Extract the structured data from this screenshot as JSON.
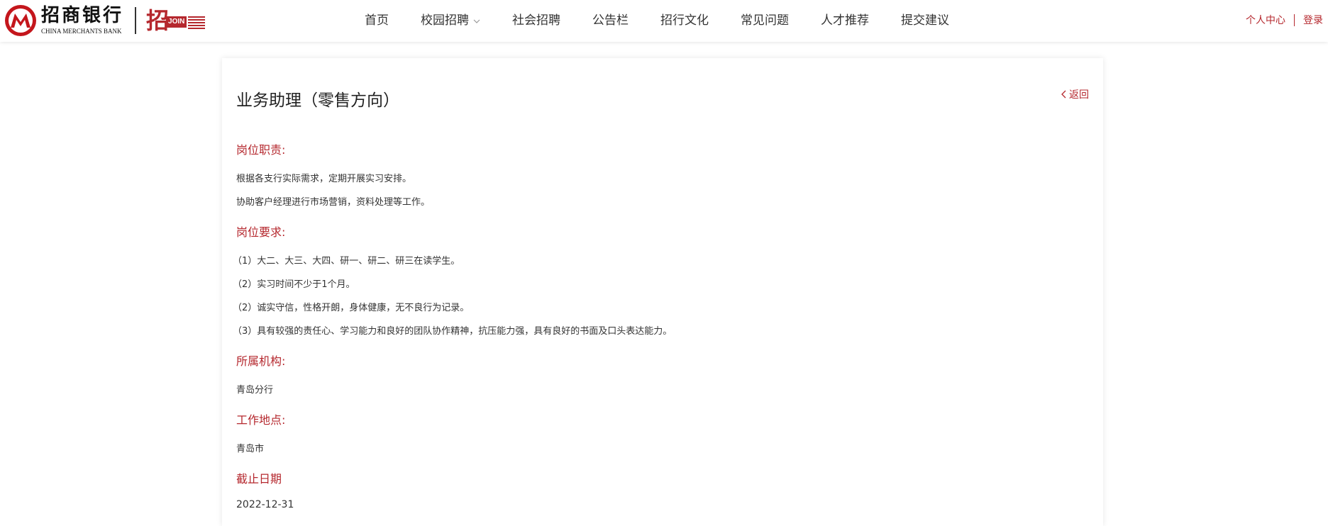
{
  "brand": {
    "name_cn": "招商银行",
    "name_en": "CHINA MERCHANTS BANK",
    "join_char": "招",
    "join_badge": "JOIN",
    "join_suffix": "US",
    "accent_color": "#b5282e"
  },
  "nav": {
    "items": [
      {
        "label": "首页"
      },
      {
        "label": "校园招聘",
        "has_dropdown": true
      },
      {
        "label": "社会招聘"
      },
      {
        "label": "公告栏"
      },
      {
        "label": "招行文化"
      },
      {
        "label": "常见问题"
      },
      {
        "label": "人才推荐"
      },
      {
        "label": "提交建议"
      }
    ]
  },
  "user": {
    "center_label": "个人中心",
    "login_label": "登录"
  },
  "job": {
    "title": "业务助理（零售方向）",
    "back_label": "返回",
    "sections": {
      "duties": {
        "label": "岗位职责:",
        "lines": [
          "根据各支行实际需求，定期开展实习安排。",
          "协助客户经理进行市场营销，资料处理等工作。"
        ]
      },
      "requirements": {
        "label": "岗位要求:",
        "lines": [
          "（1）大二、大三、大四、研一、研二、研三在读学生。",
          "（2）实习时间不少于1个月。",
          "（2）诚实守信，性格开朗，身体健康，无不良行为记录。",
          "（3）具有较强的责任心、学习能力和良好的团队协作精神，抗压能力强，具有良好的书面及口头表达能力。"
        ]
      },
      "organization": {
        "label": "所属机构:",
        "value": "青岛分行"
      },
      "location": {
        "label": "工作地点:",
        "value": "青岛市"
      },
      "deadline": {
        "label": "截止日期",
        "value": "2022-12-31"
      }
    }
  }
}
